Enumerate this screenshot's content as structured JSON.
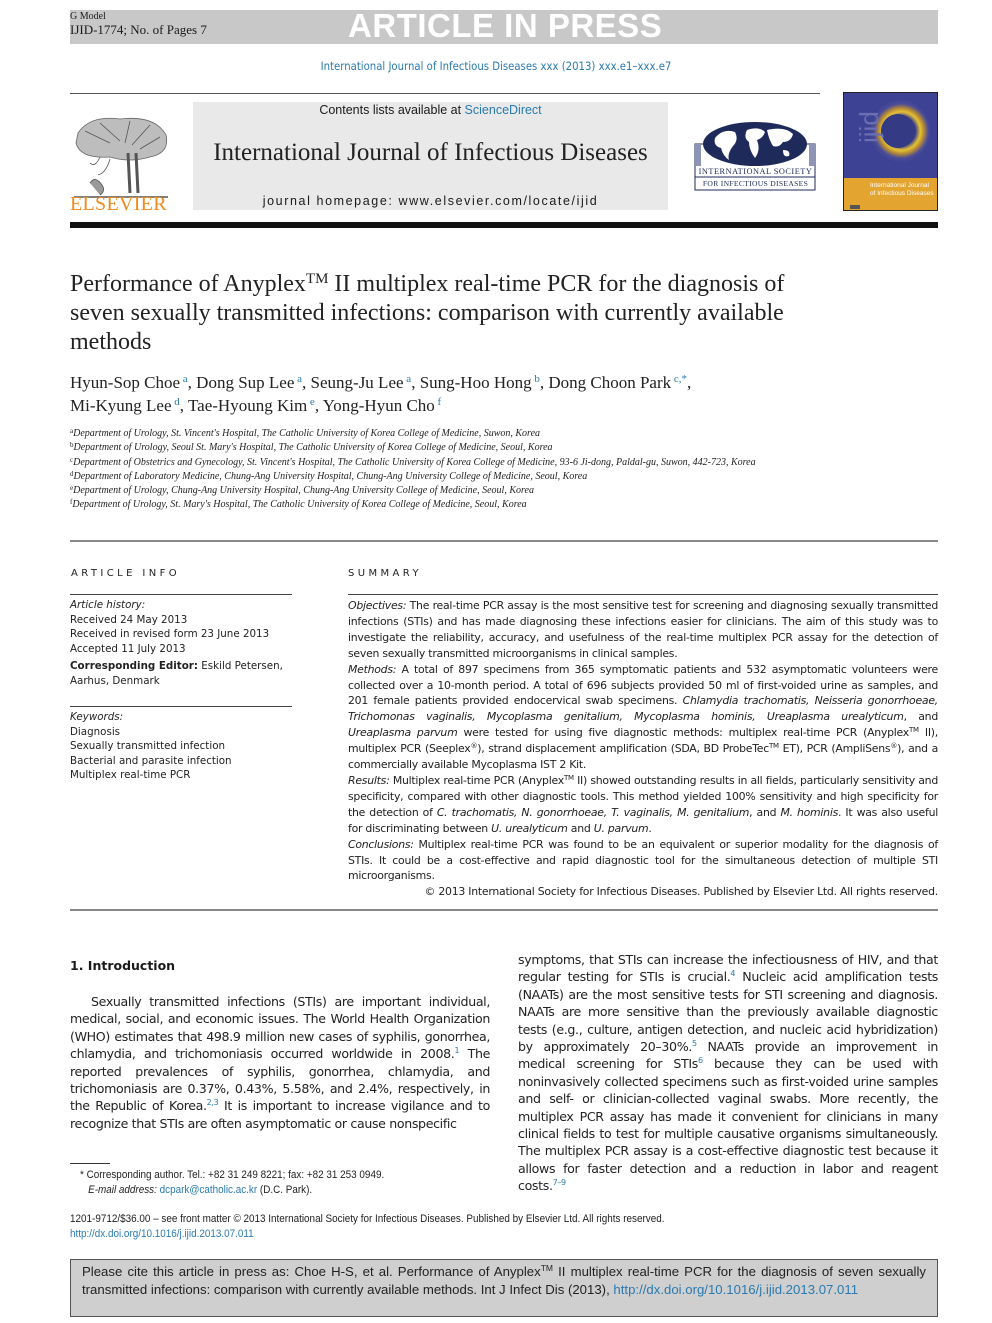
{
  "banner": {
    "g_model": "G Model",
    "ijid_ref": "IJID-1774; No. of Pages 7",
    "article_in_press": "ARTICLE IN PRESS"
  },
  "journal_ref": "International Journal of Infectious Diseases xxx (2013) xxx.e1–xxx.e7",
  "masthead": {
    "publisher_logo_text": "ELSEVIER",
    "contents_prefix": "Contents lists available at ",
    "contents_link": "ScienceDirect",
    "journal_title": "International Journal of Infectious Diseases",
    "homepage_prefix": "journal homepage: ",
    "homepage_url": "www.elsevier.com/locate/ijid",
    "society_logo_line1": "International Society",
    "society_logo_line2": "for Infectious Diseases",
    "cover_title_line1": "International Journal",
    "cover_title_line2": "of Infectious Diseases",
    "cover_watermark": "ijid",
    "brand_orange": "#f08a1c",
    "link_blue": "#2a7ab0",
    "society_navy": "#1e2a5a"
  },
  "article": {
    "title_part1": "Performance of Anyplex",
    "title_tm": "TM",
    "title_part2": " II multiplex real-time PCR for the diagnosis of seven sexually transmitted infections: comparison with currently available methods",
    "authors": [
      {
        "name": "Hyun-Sop Choe",
        "aff": "a"
      },
      {
        "name": "Dong Sup Lee",
        "aff": "a"
      },
      {
        "name": "Seung-Ju Lee",
        "aff": "a"
      },
      {
        "name": "Sung-Hoo Hong",
        "aff": "b"
      },
      {
        "name": "Dong Choon Park",
        "aff": "c,*"
      },
      {
        "name": "Mi-Kyung Lee",
        "aff": "d"
      },
      {
        "name": "Tae-Hyoung Kim",
        "aff": "e"
      },
      {
        "name": "Yong-Hyun Cho",
        "aff": "f"
      }
    ],
    "affiliations": [
      {
        "key": "a",
        "text": "Department of Urology, St. Vincent's Hospital, The Catholic University of Korea College of Medicine, Suwon, Korea"
      },
      {
        "key": "b",
        "text": "Department of Urology, Seoul St. Mary's Hospital, The Catholic University of Korea College of Medicine, Seoul, Korea"
      },
      {
        "key": "c",
        "text": "Department of Obstetrics and Gynecology, St. Vincent's Hospital, The Catholic University of Korea College of Medicine, 93-6 Ji-dong, Paldal-gu, Suwon, 442-723, Korea"
      },
      {
        "key": "d",
        "text": "Department of Laboratory Medicine, Chung-Ang University Hospital, Chung-Ang University College of Medicine, Seoul, Korea"
      },
      {
        "key": "e",
        "text": "Department of Urology, Chung-Ang University Hospital, Chung-Ang University College of Medicine, Seoul, Korea"
      },
      {
        "key": "f",
        "text": "Department of Urology, St. Mary's Hospital, The Catholic University of Korea College of Medicine, Seoul, Korea"
      }
    ]
  },
  "article_info": {
    "heading": "ARTICLE INFO",
    "history_label": "Article history:",
    "received": "Received 24 May 2013",
    "revised": "Received in revised form 23 June 2013",
    "accepted": "Accepted 11 July 2013",
    "editor_label": "Corresponding Editor:",
    "editor_value": " Eskild Petersen, Aarhus, Denmark",
    "keywords_label": "Keywords:",
    "keywords": [
      "Diagnosis",
      "Sexually transmitted infection",
      "Bacterial and parasite infection",
      "Multiplex real-time PCR"
    ]
  },
  "summary": {
    "heading": "SUMMARY",
    "objectives_label": "Objectives:",
    "objectives": " The real-time PCR assay is the most sensitive test for screening and diagnosing sexually transmitted infections (STIs) and has made diagnosing these infections easier for clinicians. The aim of this study was to investigate the reliability, accuracy, and usefulness of the real-time multiplex PCR assay for the detection of seven sexually transmitted microorganisms in clinical samples.",
    "methods_label": "Methods:",
    "methods_a": " A total of 897 specimens from 365 symptomatic patients and 532 asymptomatic volunteers were collected over a 10-month period. A total of 696 subjects provided 50 ml of first-voided urine as samples, and 201 female patients provided endocervical swab specimens. ",
    "methods_species": "Chlamydia trachomatis, Neisseria gonorrhoeae, Trichomonas vaginalis, Mycoplasma genitalium, Mycoplasma hominis, Ureaplasma urealyticum",
    "methods_b": ", and ",
    "methods_species2": "Ureaplasma parvum",
    "methods_c": " were tested for using five diagnostic methods: multiplex real-time PCR (Anyplex",
    "methods_tm1": "TM",
    "methods_d": " II), multiplex PCR (Seeplex",
    "methods_reg1": "®",
    "methods_e": "), strand displacement amplification (SDA, BD ProbeTec",
    "methods_tm2": "TM",
    "methods_f": " ET), PCR (AmpliSens",
    "methods_reg2": "®",
    "methods_g": "), and a commercially available Mycoplasma IST 2 Kit.",
    "results_label": "Results:",
    "results_a": " Multiplex real-time PCR (Anyplex",
    "results_tm": "TM",
    "results_b": " II) showed outstanding results in all fields, particularly sensitivity and specificity, compared with other diagnostic tools. This method yielded 100% sensitivity and high specificity for the detection of ",
    "results_sp1": "C. trachomatis, N. gonorrhoeae, T. vaginalis, M. genitalium",
    "results_c": ", and ",
    "results_sp2": "M. hominis",
    "results_d": ". It was also useful for discriminating between ",
    "results_sp3": "U. urealyticum",
    "results_e": " and ",
    "results_sp4": "U. parvum",
    "results_f": ".",
    "conclusions_label": "Conclusions:",
    "conclusions": " Multiplex real-time PCR was found to be an equivalent or superior modality for the diagnosis of STIs. It could be a cost-effective and rapid diagnostic tool for the simultaneous detection of multiple STI microorganisms.",
    "copyright": "© 2013 International Society for Infectious Diseases. Published by Elsevier Ltd. All rights reserved."
  },
  "introduction": {
    "heading": "1.  Introduction",
    "left_a": "Sexually transmitted infections (STIs) are important individual, medical, social, and economic issues. The World Health Organization (WHO) estimates that 498.9 million new cases of syphilis, gonorrhea, chlamydia, and trichomoniasis occurred worldwide in 2008.",
    "ref1": "1",
    "left_b": " The reported prevalences of syphilis, gonorrhea, chlamydia, and trichomoniasis are 0.37%, 0.43%, 5.58%, and 2.4%, respectively, in the Republic of Korea.",
    "ref2": "2,3",
    "left_c": " It is important to increase vigilance and to recognize that STIs are often asymptomatic or cause nonspecific",
    "right_a": "symptoms, that STIs can increase the infectiousness of HIV, and that regular testing for STIs is crucial.",
    "ref4": "4",
    "right_b": " Nucleic acid amplification tests (NAATs) are the most sensitive tests for STI screening and diagnosis. NAATs are more sensitive than the previously available diagnostic tests (e.g., culture, antigen detection, and nucleic acid hybridization) by approximately 20–30%.",
    "ref5": "5",
    "right_c": " NAATs provide an improvement in medical screening for STIs",
    "ref6": "6",
    "right_d": " because they can be used with noninvasively collected specimens such as first-voided urine samples and self- or clinician-collected vaginal swabs. More recently, the multiplex PCR assay has made it convenient for clinicians in many clinical fields to test for multiple causative organisms simultaneously. The multiplex PCR assay is a cost-effective diagnostic test because it allows for faster detection and a reduction in labor and reagent costs.",
    "ref7": "7–9"
  },
  "footnote": {
    "star_text": "* Corresponding author. Tel.: +82 31 249 8221; fax: +82 31 253 0949.",
    "email_label": "E-mail address:",
    "email": "dcpark@catholic.ac.kr",
    "email_suffix": " (D.C. Park)."
  },
  "front_matter": {
    "line1": "1201-9712/$36.00 – see front matter © 2013 International Society for Infectious Diseases. Published by Elsevier Ltd. All rights reserved.",
    "doi": "http://dx.doi.org/10.1016/j.ijid.2013.07.011"
  },
  "cite_box": {
    "text_a": "Please cite this article in press as: Choe H-S, et al. Performance of Anyplex",
    "tm": "TM",
    "text_b": " II multiplex real-time PCR for the diagnosis of seven sexually transmitted infections: comparison with currently available methods. Int J Infect Dis (2013), ",
    "doi": "http://dx.doi.org/10.1016/j.ijid.2013.07.011"
  }
}
